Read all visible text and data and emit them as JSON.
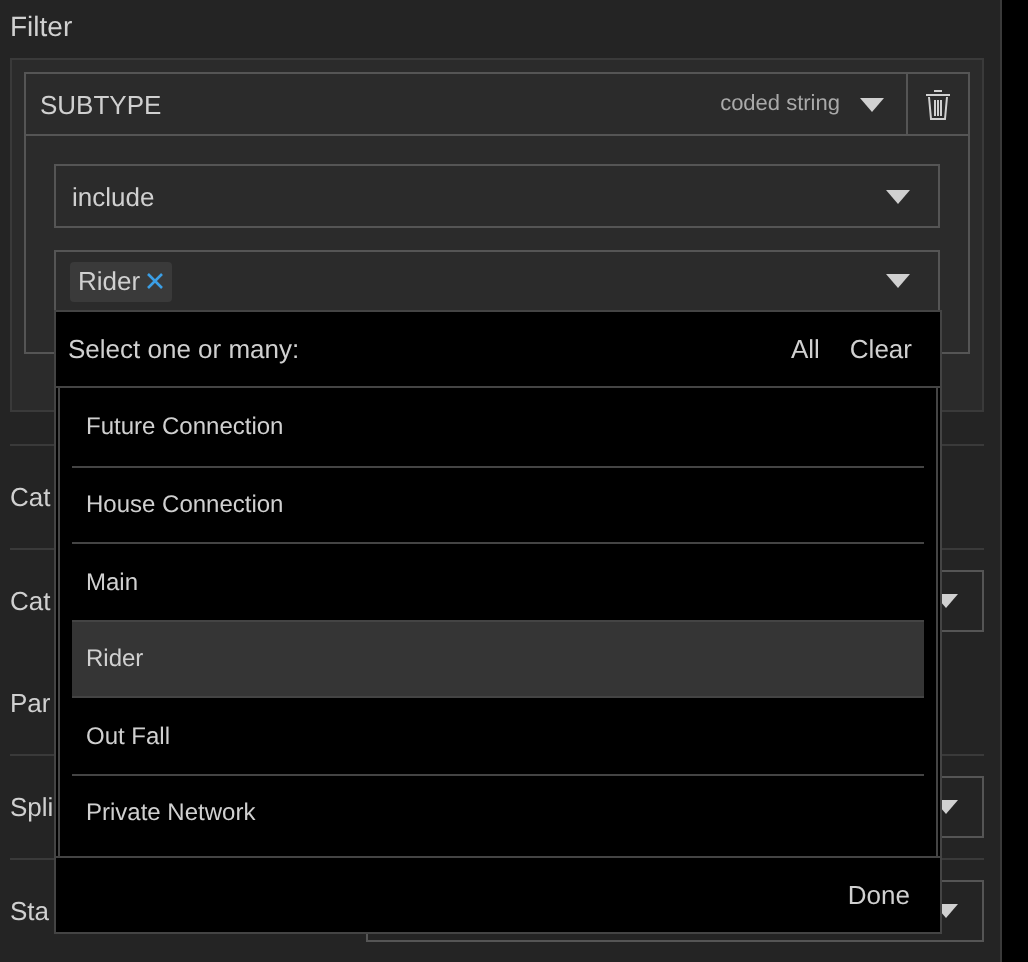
{
  "panel": {
    "title": "Filter"
  },
  "filter": {
    "field": "SUBTYPE",
    "field_type": "coded string",
    "operator": "include",
    "chips": [
      {
        "label": "Rider"
      }
    ]
  },
  "dropdown": {
    "prompt": "Select one or many:",
    "actions": [
      "All",
      "Clear"
    ],
    "options": [
      {
        "label": "Future Connection",
        "selected": false
      },
      {
        "label": "House Connection",
        "selected": false
      },
      {
        "label": "Main",
        "selected": false
      },
      {
        "label": "Rider",
        "selected": true
      },
      {
        "label": "Out Fall",
        "selected": false
      },
      {
        "label": "Private Network",
        "selected": false
      }
    ],
    "done": "Done"
  },
  "sections": [
    {
      "rows": [
        {
          "label": "Cat",
          "kind": "text"
        }
      ]
    },
    {
      "rows": [
        {
          "label": "Cat",
          "kind": "dropdown"
        },
        {
          "label": "Par",
          "kind": "text"
        }
      ]
    },
    {
      "rows": [
        {
          "label": "Spli",
          "kind": "dropdown"
        }
      ]
    },
    {
      "rows": [
        {
          "label": "Sta",
          "kind": "dropdown"
        }
      ]
    }
  ]
}
